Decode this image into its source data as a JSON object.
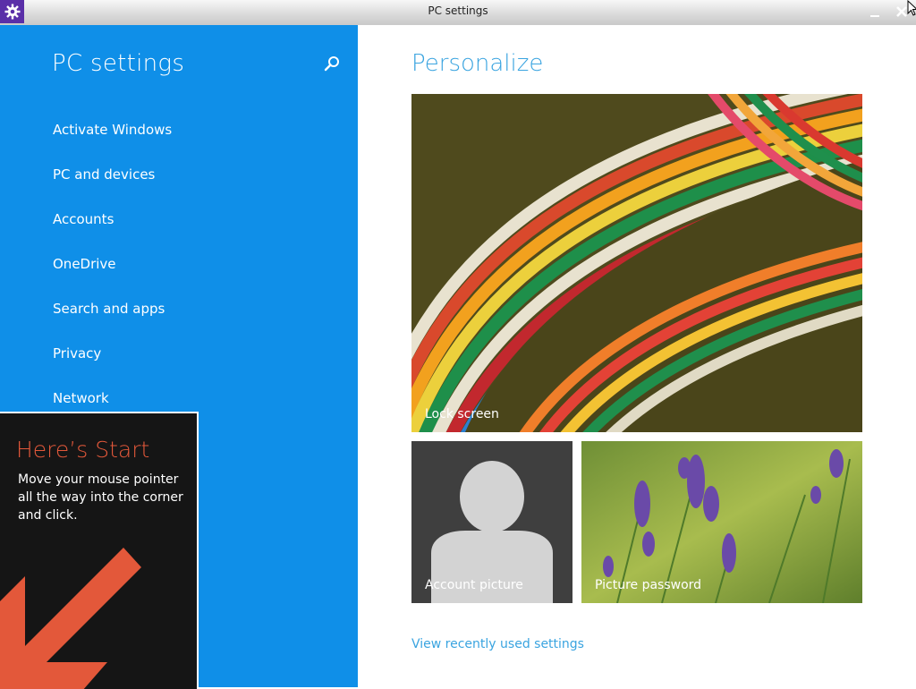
{
  "window": {
    "title": "PC settings",
    "app_icon": "gear-icon",
    "minimize_icon": "minimize-icon",
    "close_icon": "close-icon"
  },
  "sidebar": {
    "title": "PC settings",
    "search_icon": "search-icon",
    "items": [
      {
        "label": "Activate Windows"
      },
      {
        "label": "PC and devices"
      },
      {
        "label": "Accounts"
      },
      {
        "label": "OneDrive"
      },
      {
        "label": "Search and apps"
      },
      {
        "label": "Privacy"
      },
      {
        "label": "Network"
      }
    ]
  },
  "tip": {
    "title": "Here’s Start",
    "text": "Move your mouse pointer all the way into the corner and click.",
    "arrow_icon": "arrow-down-left-icon"
  },
  "main": {
    "title": "Personalize",
    "tiles": {
      "lock_screen": "Lock screen",
      "account_picture": "Account picture",
      "picture_password": "Picture password"
    },
    "recent_link": "View recently used settings"
  },
  "colors": {
    "sidebar_bg": "#0f8fe8",
    "accent_text": "#3aa4e0",
    "tip_bg": "#151515",
    "tip_title": "#e3583a",
    "app_icon_bg": "#5a2fa8"
  }
}
